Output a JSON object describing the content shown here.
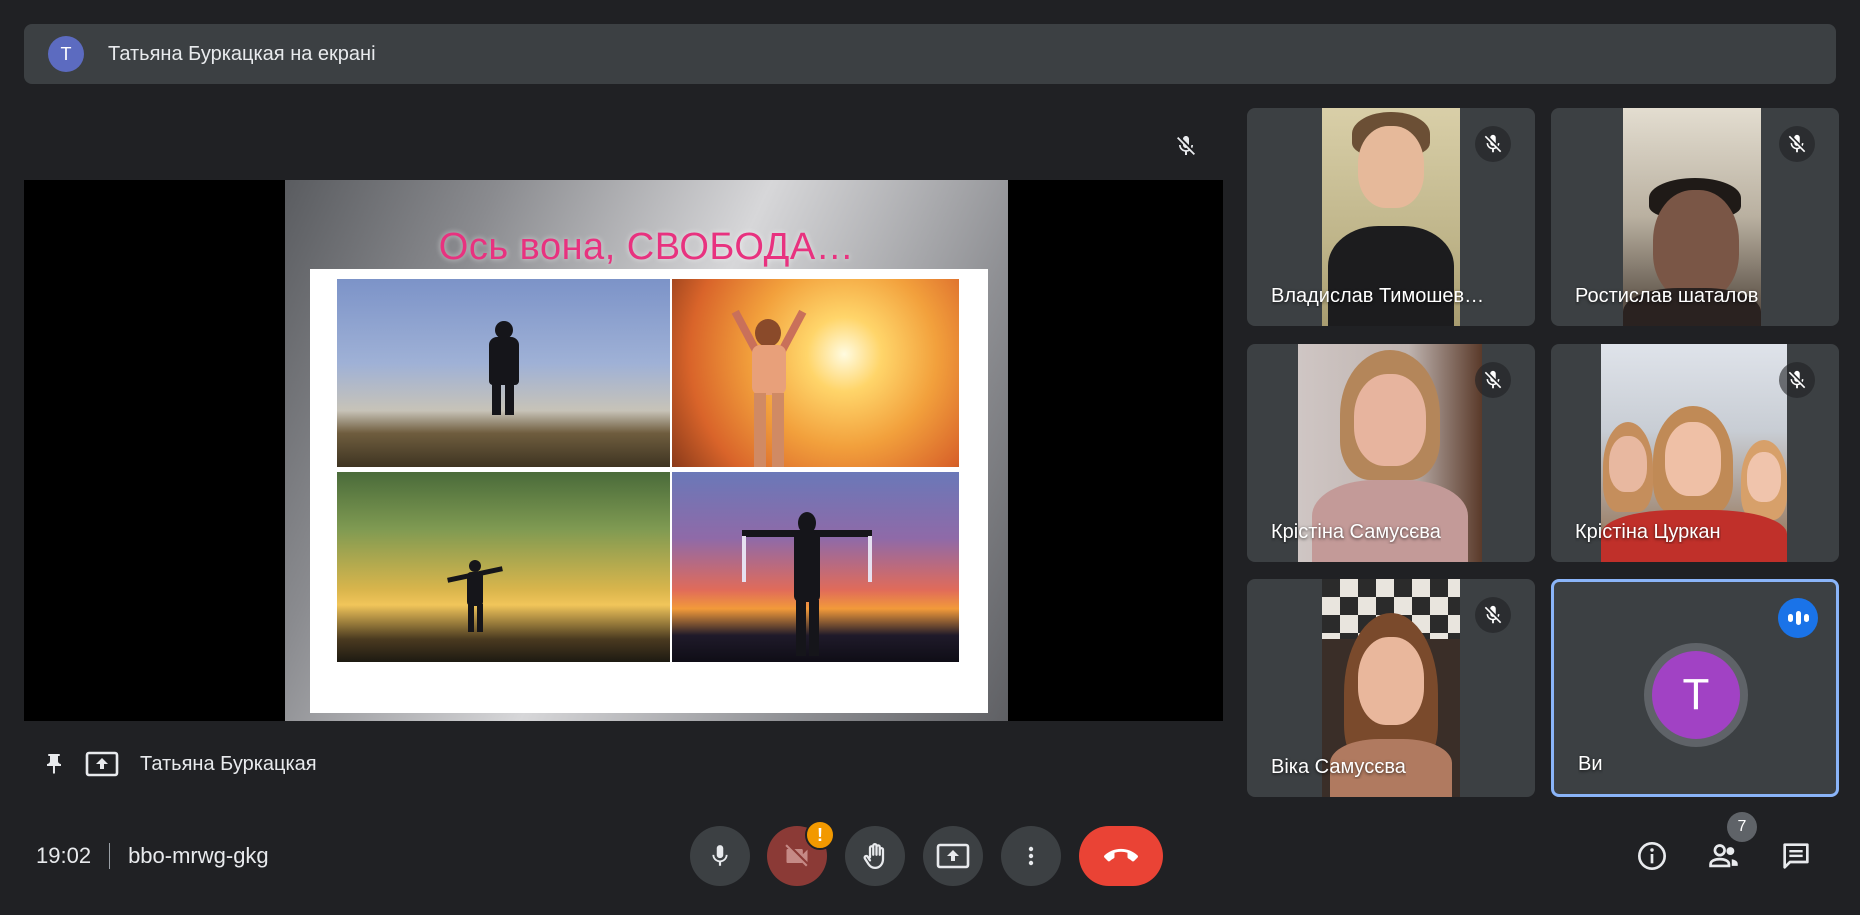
{
  "banner": {
    "avatar_letter": "Т",
    "text": "Татьяна Буркацкая на екрані"
  },
  "presentation": {
    "slide_title": "Ось вона, СВОБОДА…",
    "presenter_name": "Татьяна Буркацкая"
  },
  "participants": [
    {
      "name": "Владислав Тимошев…",
      "muted": true
    },
    {
      "name": "Ростислав шаталов",
      "muted": true
    },
    {
      "name": "Крістіна Самусєва",
      "muted": true
    },
    {
      "name": "Крістіна Цуркан",
      "muted": true
    },
    {
      "name": "Віка Самусєва",
      "muted": true
    }
  ],
  "self_tile": {
    "label": "Ви",
    "avatar_letter": "Т",
    "speaking": true
  },
  "meeting": {
    "time": "19:02",
    "code": "bbo-mrwg-gkg"
  },
  "controls": {
    "camera_alert": "!",
    "participants_count": "7"
  },
  "colors": {
    "background": "#202124",
    "tile": "#3c4043",
    "end_call": "#ea4335",
    "camera_off": "#8b3a36",
    "alert": "#f29900",
    "self_border": "#8ab4f8",
    "self_avatar": "#a142c4",
    "speaking": "#1a73e8",
    "slide_title": "#e8327f"
  },
  "icons": {
    "stage_mute": "mic-off-icon",
    "pin": "pin-icon",
    "present": "present-to-all-icon",
    "mic": "mic-icon",
    "camera": "videocam-off-icon",
    "hand": "raise-hand-icon",
    "share": "present-icon",
    "more": "more-vert-icon",
    "end": "call-end-icon",
    "info": "info-icon",
    "people": "people-icon",
    "chat": "chat-icon"
  }
}
